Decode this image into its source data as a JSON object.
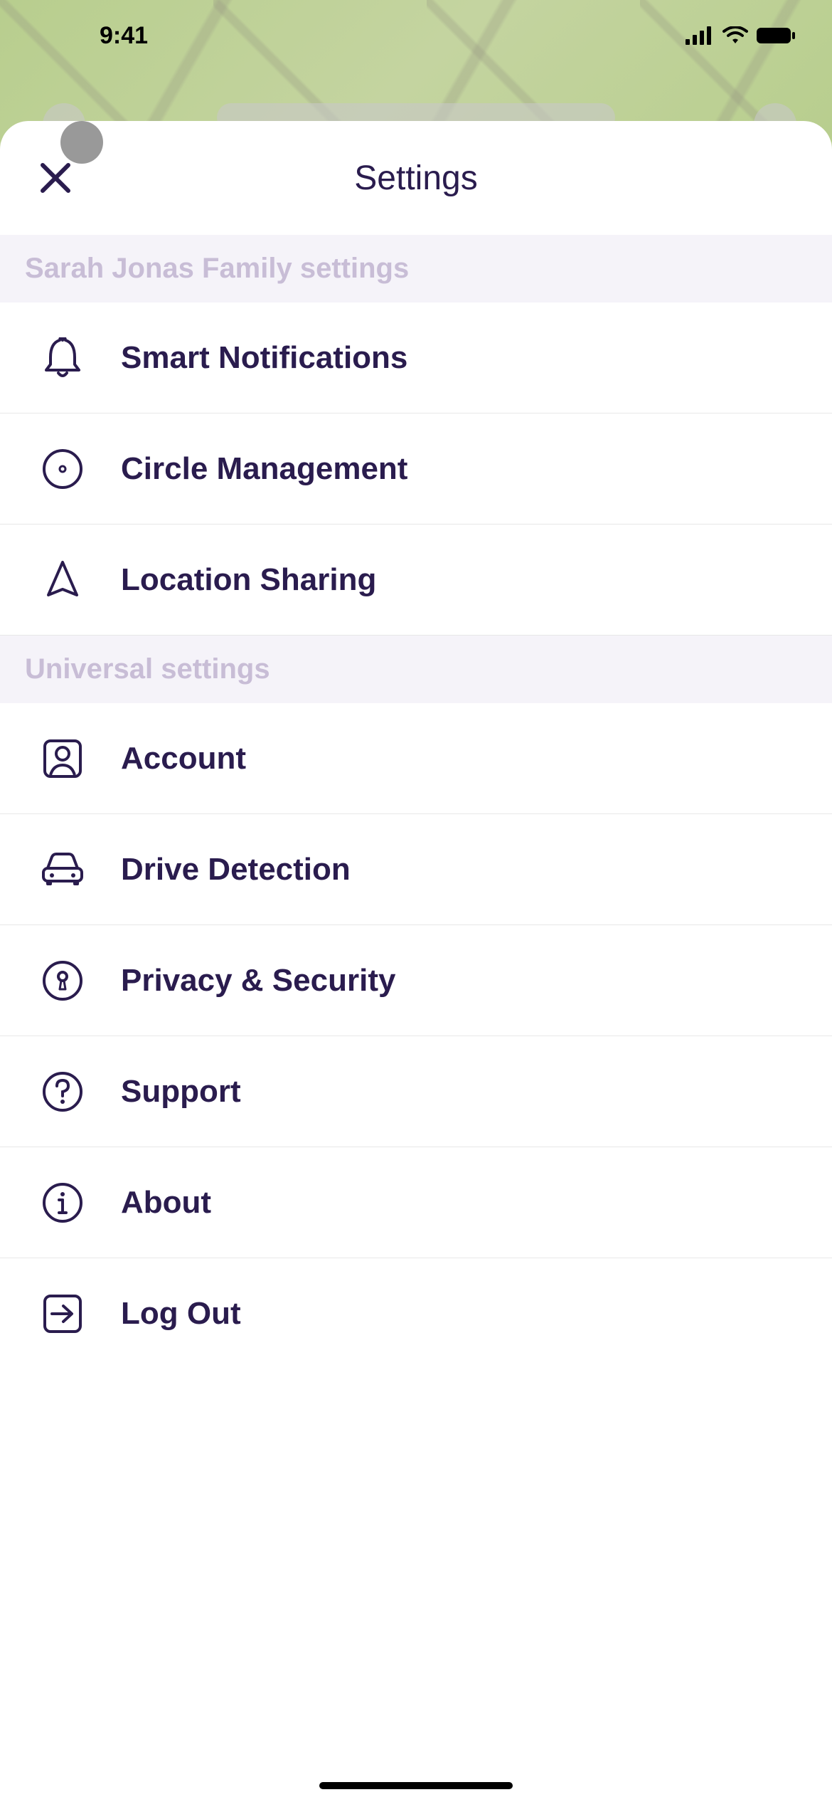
{
  "status": {
    "time": "9:41"
  },
  "sheet": {
    "title": "Settings"
  },
  "sections": [
    {
      "header": "Sarah Jonas Family settings",
      "items": [
        {
          "icon": "bell",
          "label": "Smart Notifications",
          "name": "smart-notifications"
        },
        {
          "icon": "circle",
          "label": "Circle Management",
          "name": "circle-management"
        },
        {
          "icon": "location",
          "label": "Location Sharing",
          "name": "location-sharing"
        }
      ]
    },
    {
      "header": "Universal settings",
      "items": [
        {
          "icon": "account",
          "label": "Account",
          "name": "account"
        },
        {
          "icon": "car",
          "label": "Drive Detection",
          "name": "drive-detection"
        },
        {
          "icon": "lock",
          "label": "Privacy & Security",
          "name": "privacy-security"
        },
        {
          "icon": "help",
          "label": "Support",
          "name": "support"
        },
        {
          "icon": "info",
          "label": "About",
          "name": "about"
        },
        {
          "icon": "logout",
          "label": "Log Out",
          "name": "log-out"
        }
      ]
    }
  ]
}
